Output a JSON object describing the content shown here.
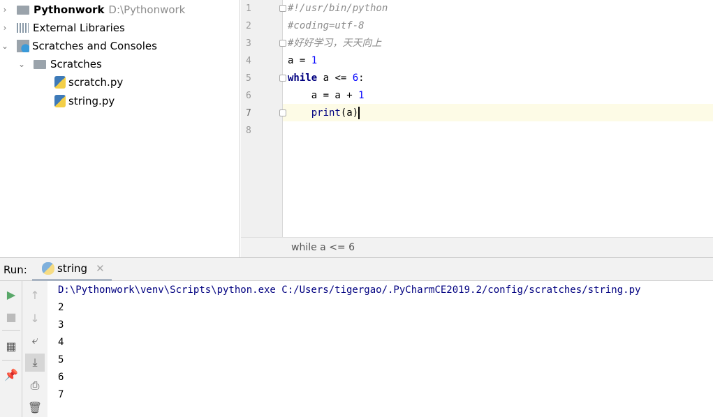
{
  "project": {
    "items": [
      {
        "label": "Pythonwork",
        "path": "D:\\Pythonwork"
      },
      {
        "label": "External Libraries"
      },
      {
        "label": "Scratches and Consoles"
      },
      {
        "label": "Scratches"
      },
      {
        "label": "scratch.py"
      },
      {
        "label": "string.py"
      }
    ]
  },
  "editor": {
    "line_numbers": [
      "1",
      "2",
      "3",
      "4",
      "5",
      "6",
      "7",
      "8"
    ],
    "lines": {
      "l1": "#!/usr/bin/python",
      "l2": "#coding=utf-8",
      "l3": "#好好学习，天天向上",
      "l4a": "a = ",
      "l4b": "1",
      "l5a": "while",
      "l5b": " a <= ",
      "l5c": "6",
      "l5d": ":",
      "l6a": "    a = a + ",
      "l6b": "1",
      "l7a": "    ",
      "l7b": "print",
      "l7c": "(a)"
    },
    "breadcrumb": "while a <= 6"
  },
  "run": {
    "label": "Run:",
    "tab": "string",
    "command": "D:\\Pythonwork\\venv\\Scripts\\python.exe C:/Users/tigergao/.PyCharmCE2019.2/config/scratches/string.py",
    "output": [
      "2",
      "3",
      "4",
      "5",
      "6",
      "7"
    ]
  },
  "colors": {
    "command": "#000080",
    "keyword": "#000080",
    "number": "#0000ff",
    "comment": "#8c8c8c",
    "run_green": "#59a869"
  }
}
